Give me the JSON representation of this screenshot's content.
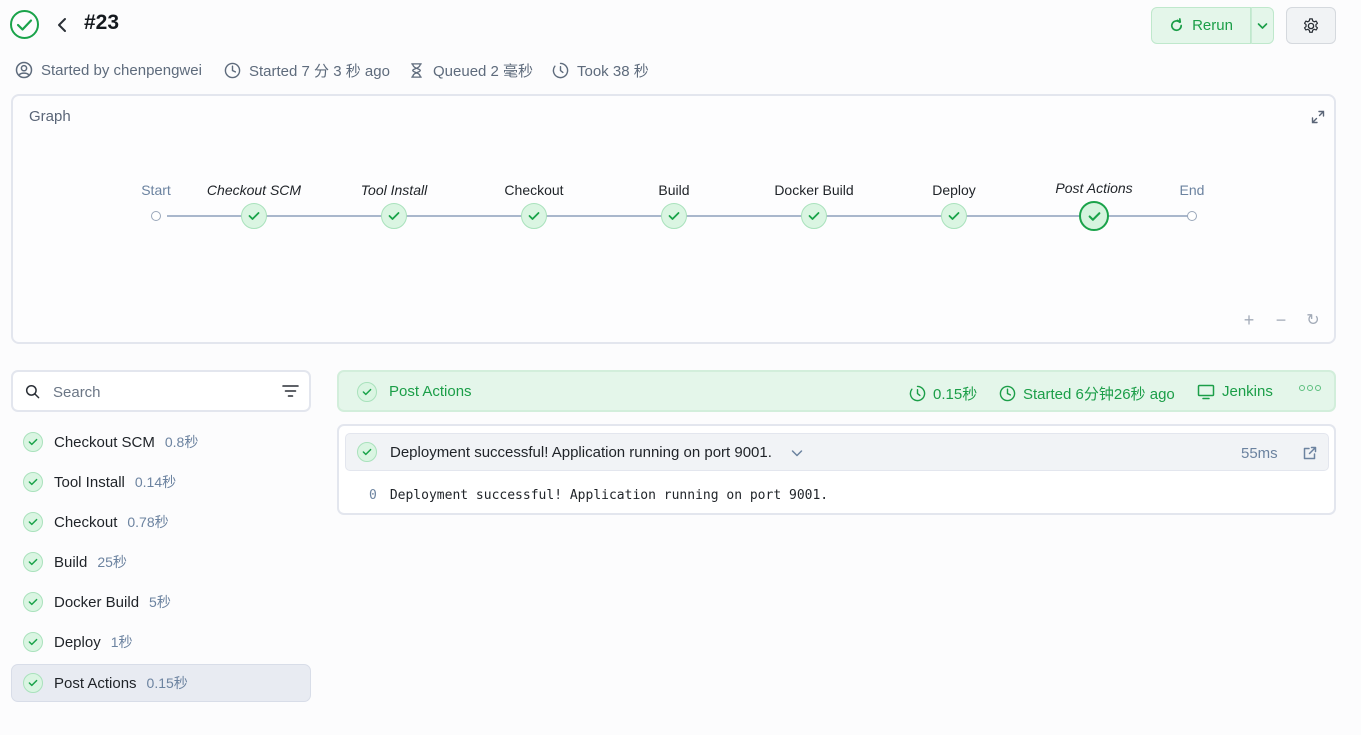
{
  "header": {
    "run_title": "#23",
    "rerun_label": "Rerun"
  },
  "meta": {
    "started_by": "Started by chenpengwei",
    "started": "Started 7 分 3 秒 ago",
    "queued": "Queued 2 毫秒",
    "took": "Took 38 秒"
  },
  "graph": {
    "title": "Graph",
    "start_label": "Start",
    "end_label": "End",
    "nodes": [
      {
        "label": "Checkout SCM"
      },
      {
        "label": "Tool Install"
      },
      {
        "label": "Checkout"
      },
      {
        "label": "Build"
      },
      {
        "label": "Docker Build"
      },
      {
        "label": "Deploy"
      },
      {
        "label": "Post Actions"
      }
    ],
    "zoom_in": "+",
    "zoom_out": "−",
    "reset": "↻"
  },
  "search": {
    "placeholder": "Search"
  },
  "stages": [
    {
      "name": "Checkout SCM",
      "duration": "0.8秒"
    },
    {
      "name": "Tool Install",
      "duration": "0.14秒"
    },
    {
      "name": "Checkout",
      "duration": "0.78秒"
    },
    {
      "name": "Build",
      "duration": "25秒"
    },
    {
      "name": "Docker Build",
      "duration": "5秒"
    },
    {
      "name": "Deploy",
      "duration": "1秒"
    },
    {
      "name": "Post Actions",
      "duration": "0.15秒"
    }
  ],
  "stage_detail": {
    "title": "Post Actions",
    "duration": "0.15秒",
    "started": "Started 6分钟26秒 ago",
    "agent": "Jenkins"
  },
  "log": {
    "step_title": "Deployment successful! Application running on port 9001.",
    "step_duration": "55ms",
    "lines": [
      {
        "no": "0",
        "text": "Deployment successful! Application running on port 9001."
      }
    ]
  },
  "colors": {
    "success": "#1aa34a",
    "success_bg": "#e4f6ea",
    "muted": "#6c83a0"
  }
}
